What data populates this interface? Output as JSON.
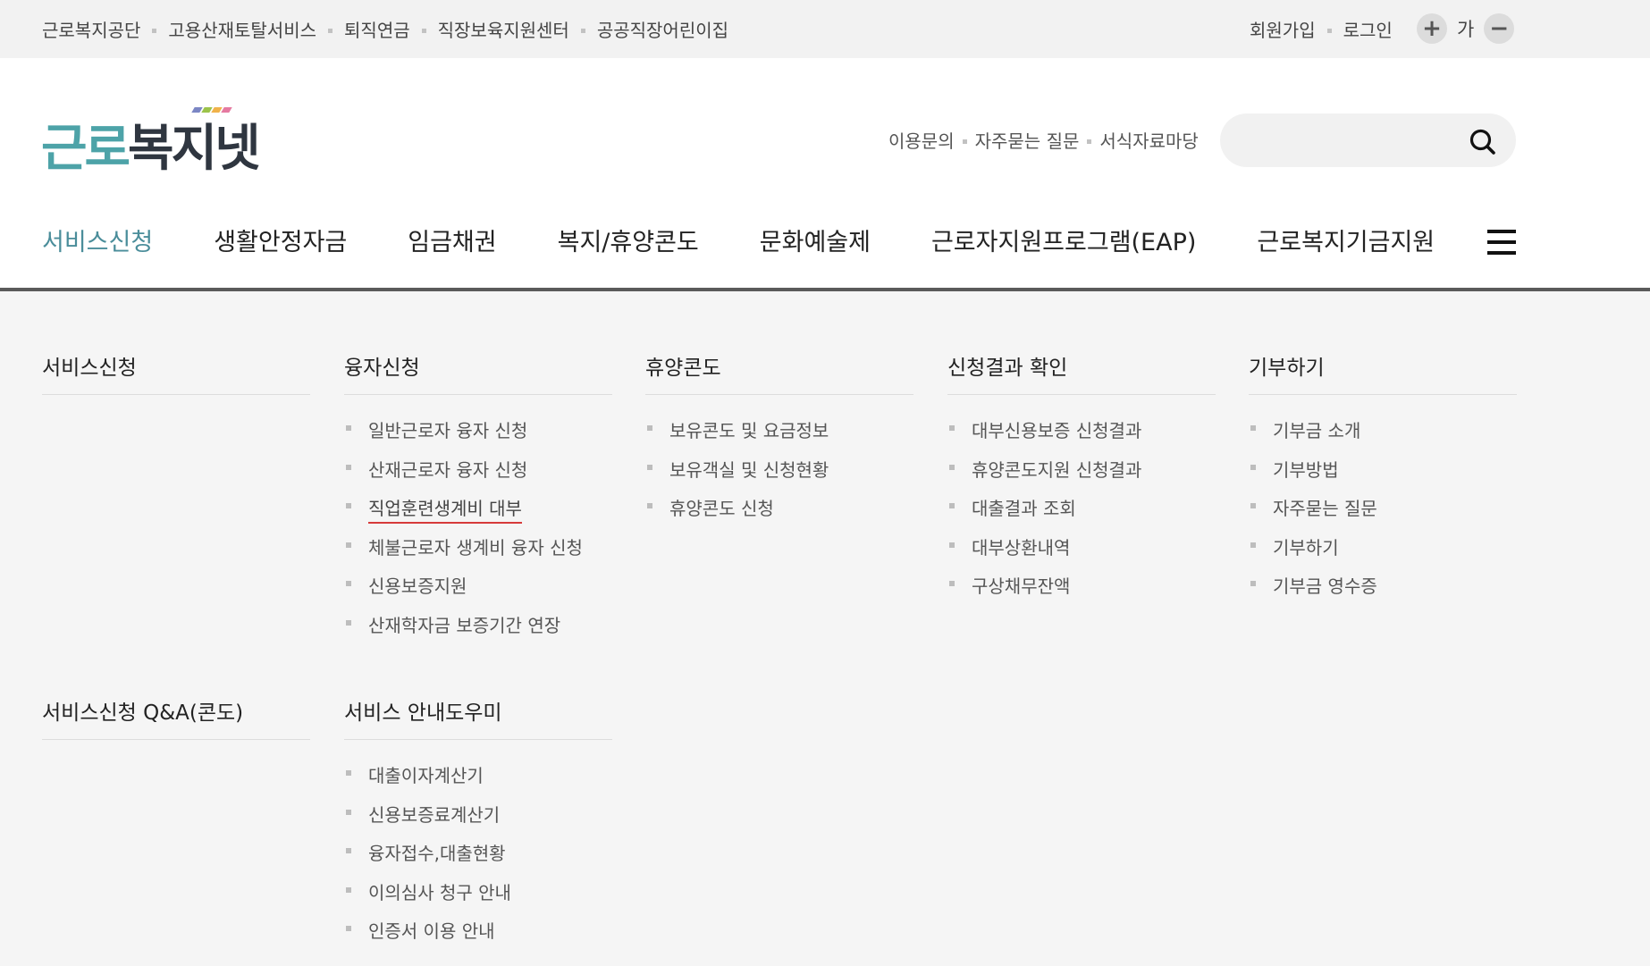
{
  "topbar": {
    "site_links": [
      "근로복지공단",
      "고용산재토탈서비스",
      "퇴직연금",
      "직장보육지원센터",
      "공공직장어린이집"
    ],
    "user_links": [
      "회원가입",
      "로그인"
    ],
    "font_size": {
      "increase_symbol": "+",
      "label": "가",
      "decrease_symbol": "−"
    }
  },
  "header": {
    "logo": {
      "part_a": "근로",
      "part_b": "복지넷"
    },
    "quick_links": [
      "이용문의",
      "자주묻는 질문",
      "서식자료마당"
    ],
    "search": {
      "placeholder": "",
      "value": "",
      "icon": "search-icon"
    }
  },
  "gnb": {
    "items": [
      "서비스신청",
      "생활안정자금",
      "임금채권",
      "복지/휴양콘도",
      "문화예술제",
      "근로자지원프로그램(EAP)",
      "근로복지기금지원"
    ],
    "active_index": 0,
    "menu_icon": "hamburger-icon"
  },
  "mega_menu": {
    "columns": [
      {
        "title": "서비스신청",
        "items": []
      },
      {
        "title": "융자신청",
        "items": [
          "일반근로자 융자 신청",
          "산재근로자 융자 신청",
          "직업훈련생계비 대부",
          "체불근로자 생계비 융자 신청",
          "신용보증지원",
          "산재학자금 보증기간 연장"
        ]
      },
      {
        "title": "휴양콘도",
        "items": [
          "보유콘도 및 요금정보",
          "보유객실 및 신청현황",
          "휴양콘도 신청"
        ]
      },
      {
        "title": "신청결과 확인",
        "items": [
          "대부신용보증 신청결과",
          "휴양콘도지원 신청결과",
          "대출결과 조회",
          "대부상환내역",
          "구상채무잔액"
        ]
      },
      {
        "title": "기부하기",
        "items": [
          "기부금 소개",
          "기부방법",
          "자주묻는 질문",
          "기부하기",
          "기부금 영수증"
        ]
      },
      {
        "title": "서비스신청 Q&A(콘도)",
        "items": []
      },
      {
        "title": "서비스 안내도우미",
        "items": [
          "대출이자계산기",
          "신용보증료계산기",
          "융자접수,대출현황",
          "이의심사 청구 안내",
          "인증서 이용 안내"
        ]
      }
    ],
    "hovered_item": "직업훈련생계비 대부"
  },
  "colors": {
    "accent_teal": "#4a8d9a",
    "logo_teal": "#4da3a8",
    "logo_dark": "#2f3640",
    "hover_underline": "#d63a3a"
  }
}
